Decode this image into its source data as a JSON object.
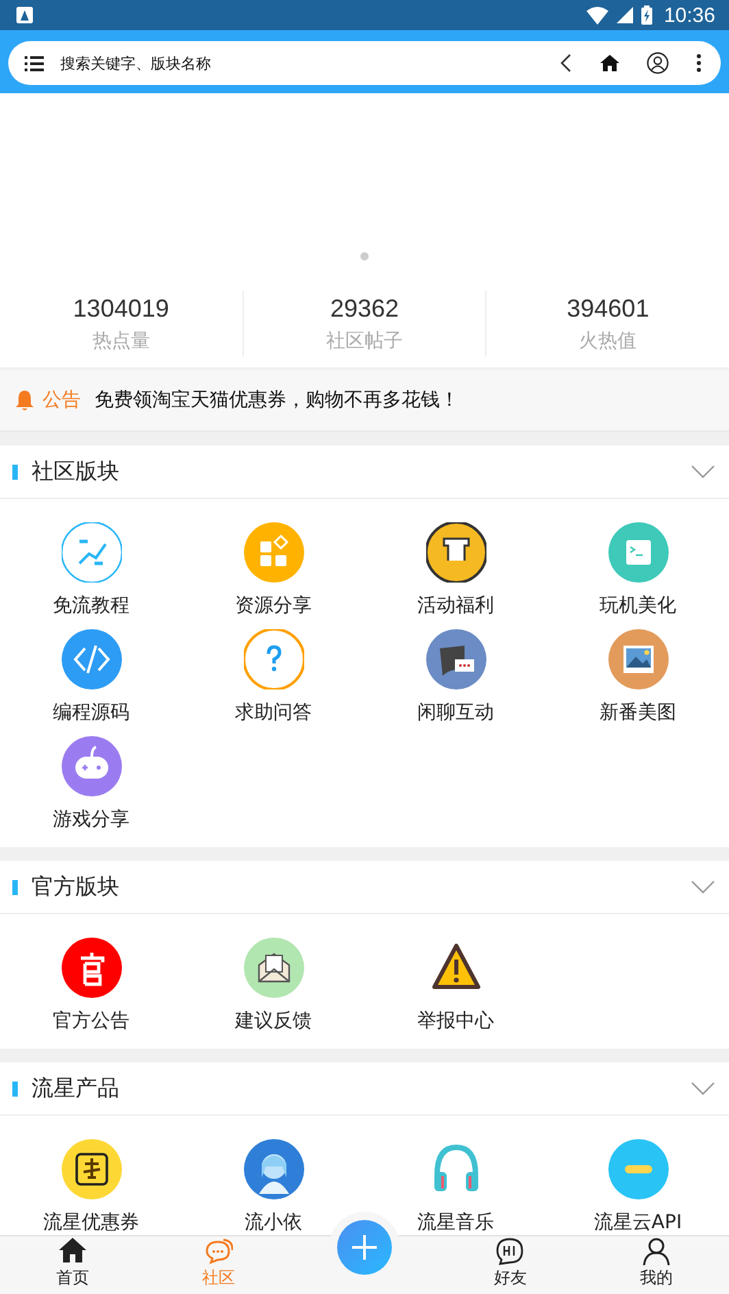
{
  "status_bar": {
    "time": "10:36"
  },
  "search": {
    "placeholder": "搜索关键字、版块名称"
  },
  "banner": {
    "pages": [
      {
        "selected": true
      }
    ]
  },
  "stats": [
    {
      "value": "1304019",
      "label": "热点量"
    },
    {
      "value": "29362",
      "label": "社区帖子"
    },
    {
      "value": "394601",
      "label": "火热值"
    }
  ],
  "notice": {
    "tag": "公告",
    "text": "免费领淘宝天猫优惠券，购物不再多花钱！"
  },
  "sections": [
    {
      "title": "社区版块",
      "items": [
        {
          "label": "免流教程"
        },
        {
          "label": "资源分享"
        },
        {
          "label": "活动福利"
        },
        {
          "label": "玩机美化"
        },
        {
          "label": "编程源码"
        },
        {
          "label": "求助问答"
        },
        {
          "label": "闲聊互动"
        },
        {
          "label": "新番美图"
        },
        {
          "label": "游戏分享"
        }
      ]
    },
    {
      "title": "官方版块",
      "items": [
        {
          "label": "官方公告"
        },
        {
          "label": "建议反馈"
        },
        {
          "label": "举报中心"
        }
      ]
    },
    {
      "title": "流星产品",
      "items": [
        {
          "label": "流星优惠券"
        },
        {
          "label": "流小依"
        },
        {
          "label": "流星音乐"
        },
        {
          "label": "流星云API"
        }
      ]
    }
  ],
  "nav": [
    {
      "label": "首页",
      "selected": false
    },
    {
      "label": "社区",
      "selected": true
    },
    {
      "kind": "add"
    },
    {
      "label": "好友",
      "selected": false
    },
    {
      "label": "我的",
      "selected": false
    }
  ]
}
